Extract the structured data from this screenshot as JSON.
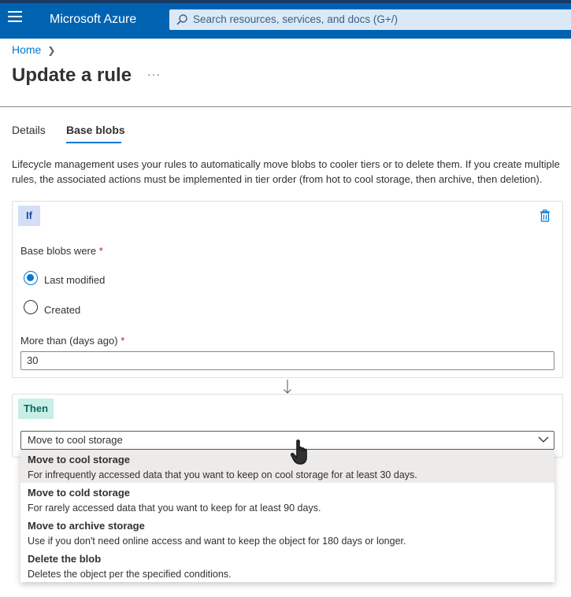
{
  "header": {
    "brand": "Microsoft Azure",
    "search_placeholder": "Search resources, services, and docs (G+/)",
    "menu_icon": "hamburger-icon",
    "search_icon": "search-icon",
    "accent": "#0063b1"
  },
  "breadcrumb": {
    "home": "Home",
    "separator": "chevron-right-icon"
  },
  "page": {
    "title": "Update a rule",
    "more": "···"
  },
  "tabs": [
    {
      "label": "Details",
      "active": false
    },
    {
      "label": "Base blobs",
      "active": true
    }
  ],
  "description": "Lifecycle management uses your rules to automatically move blobs to cooler tiers or to delete them. If you create multiple rules, the associated actions must be implemented in tier order (from hot to cool storage, then archive, then deletion).",
  "if_block": {
    "badge": "If",
    "delete_icon": "trash-icon",
    "base_blobs_label": "Base blobs were",
    "required_mark": "*",
    "options": [
      {
        "label": "Last modified",
        "checked": true
      },
      {
        "label": "Created",
        "checked": false
      }
    ],
    "days_label": "More than (days ago)",
    "days_value": "30"
  },
  "then_block": {
    "badge": "Then",
    "selected": "Move to cool storage",
    "dropdown_icon": "chevron-down-icon",
    "options": [
      {
        "title": "Move to cool storage",
        "desc": "For infrequently accessed data that you want to keep on cool storage for at least 30 days.",
        "highlighted": true
      },
      {
        "title": "Move to cold storage",
        "desc": "For rarely accessed data that you want to keep for at least 90 days.",
        "highlighted": false
      },
      {
        "title": "Move to archive storage",
        "desc": "Use if you don't need online access and want to keep the object for 180 days or longer.",
        "highlighted": false
      },
      {
        "title": "Delete the blob",
        "desc": "Deletes the object per the specified conditions.",
        "highlighted": false
      }
    ]
  }
}
